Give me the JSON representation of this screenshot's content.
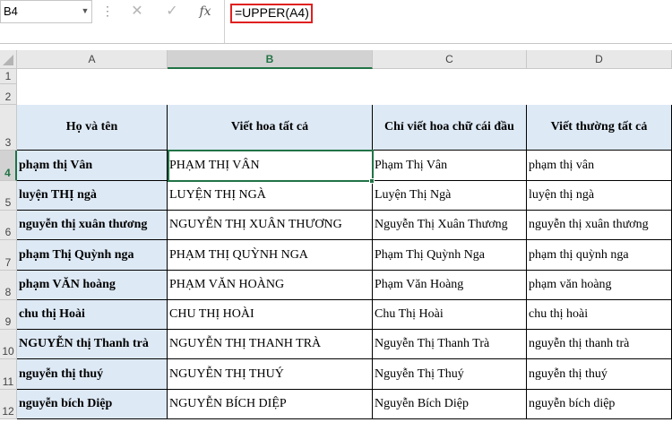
{
  "formula_bar": {
    "name_box": "B4",
    "dots": "⋮",
    "cancel_glyph": "✕",
    "enter_glyph": "✓",
    "fx_label": "fx",
    "formula": "=UPPER(A4)"
  },
  "columns": [
    "A",
    "B",
    "C",
    "D"
  ],
  "rows": [
    "1",
    "2",
    "3",
    "4",
    "5",
    "6",
    "7",
    "8",
    "9",
    "10",
    "11",
    "12"
  ],
  "table": {
    "headers": [
      "Họ và tên",
      "Viết hoa tất cả",
      "Chỉ viết hoa chữ cái đầu",
      "Viết thường tất cả"
    ],
    "data": [
      [
        "phạm thị Vân",
        "PHẠM THỊ VÂN",
        "Phạm Thị Vân",
        "phạm thị vân"
      ],
      [
        "luyện THỊ ngà",
        "LUYỆN THỊ NGÀ",
        "Luyện Thị Ngà",
        "luyện thị ngà"
      ],
      [
        "nguyễn thị xuân thương",
        "NGUYỄN THỊ XUÂN THƯƠNG",
        "Nguyễn Thị Xuân Thương",
        "nguyễn thị xuân thương"
      ],
      [
        "phạm Thị Quỳnh nga",
        "PHẠM THỊ QUỲNH NGA",
        "Phạm Thị Quỳnh Nga",
        "phạm thị quỳnh nga"
      ],
      [
        "phạm VĂN hoàng",
        "PHẠM VĂN HOÀNG",
        "Phạm Văn Hoàng",
        "phạm văn hoàng"
      ],
      [
        "chu thị Hoài",
        "CHU THỊ HOÀI",
        "Chu Thị Hoài",
        "chu thị hoài"
      ],
      [
        "NGUYỄN thị Thanh trà",
        "NGUYỄN THỊ THANH TRÀ",
        "Nguyễn Thị Thanh Trà",
        "nguyễn thị thanh trà"
      ],
      [
        "nguyễn thị thuý",
        "NGUYỄN THỊ THUÝ",
        "Nguyễn Thị Thuý",
        "nguyễn thị thuý"
      ],
      [
        "nguyễn bích Diệp",
        "NGUYỄN BÍCH DIỆP",
        "Nguyễn Bích Diệp",
        "nguyễn bích diệp"
      ]
    ]
  },
  "selection": {
    "cell": "B4",
    "accent": "#217346",
    "formula_highlight": "#e02020",
    "table_fill": "#dde9f5"
  }
}
